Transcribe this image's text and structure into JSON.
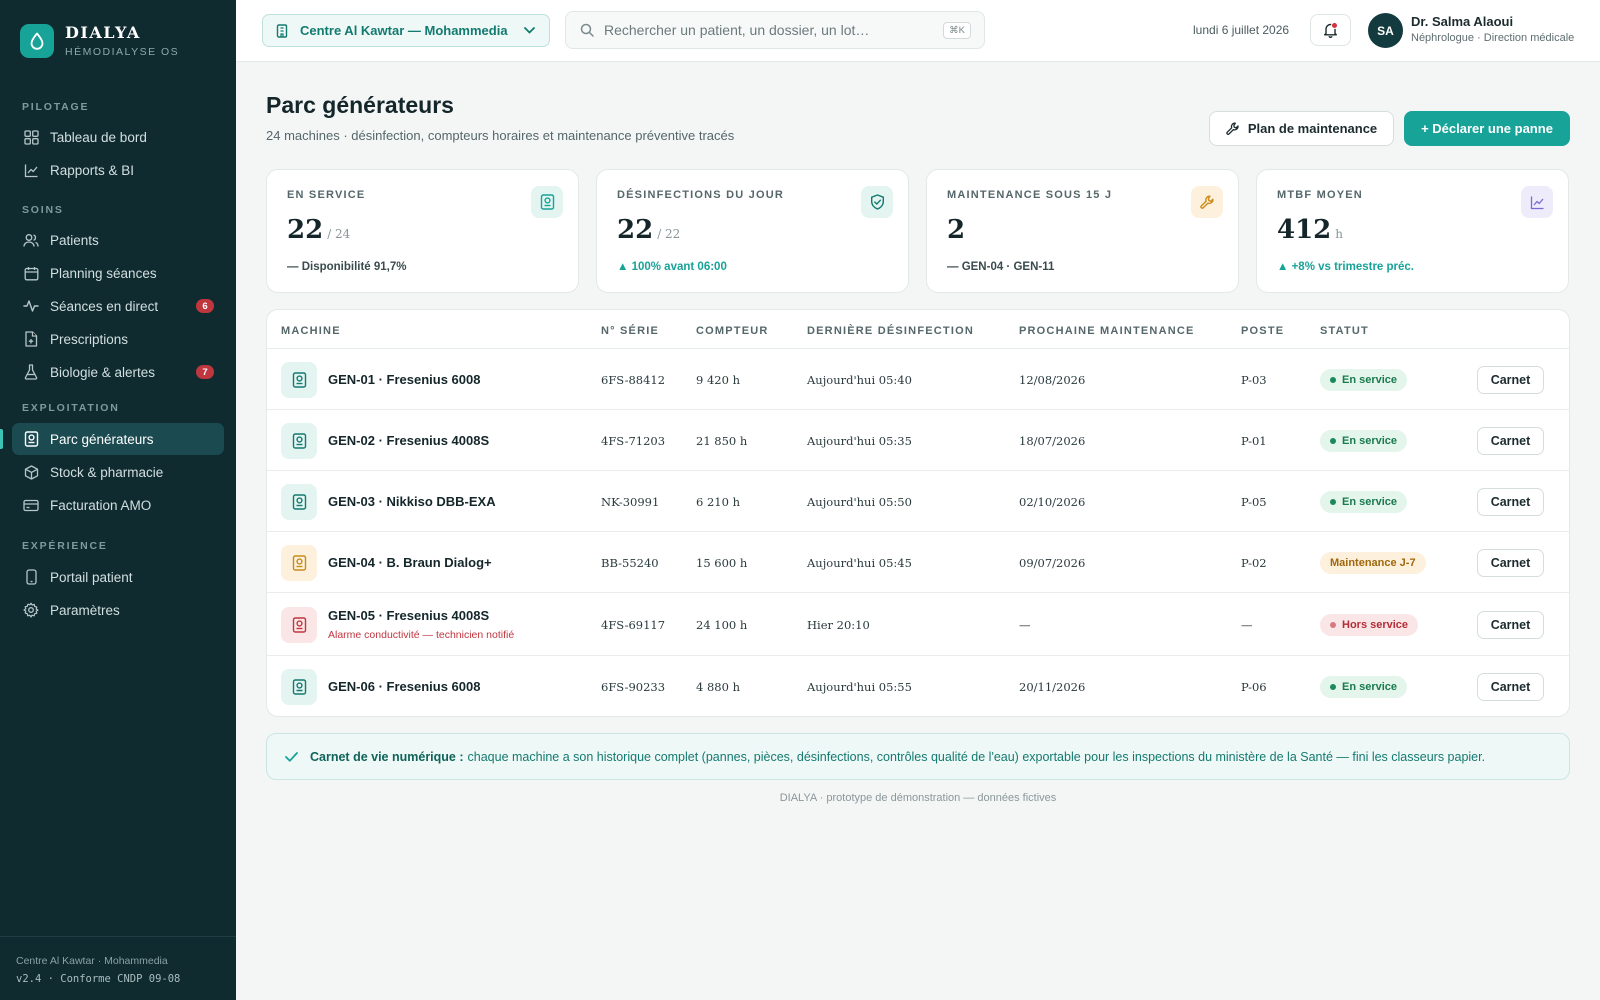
{
  "brand": {
    "name": "DIALYA",
    "subtitle": "HÉMODIALYSE OS"
  },
  "sidebar": {
    "sections": [
      {
        "label": "PILOTAGE",
        "items": [
          {
            "label": "Tableau de bord",
            "icon": "grid-icon"
          },
          {
            "label": "Rapports & BI",
            "icon": "chart-line-icon"
          }
        ]
      },
      {
        "label": "SOINS",
        "items": [
          {
            "label": "Patients",
            "icon": "users-icon"
          },
          {
            "label": "Planning séances",
            "icon": "calendar-icon"
          },
          {
            "label": "Séances en direct",
            "icon": "activity-icon",
            "badge": "6"
          },
          {
            "label": "Prescriptions",
            "icon": "file-plus-icon"
          },
          {
            "label": "Biologie & alertes",
            "icon": "flask-icon",
            "badge": "7"
          }
        ]
      },
      {
        "label": "EXPLOITATION",
        "items": [
          {
            "label": "Parc générateurs",
            "icon": "machine-icon",
            "active": true
          },
          {
            "label": "Stock & pharmacie",
            "icon": "box-icon"
          },
          {
            "label": "Facturation AMO",
            "icon": "credit-card-icon"
          }
        ]
      },
      {
        "label": "EXPÉRIENCE",
        "items": [
          {
            "label": "Portail patient",
            "icon": "phone-icon"
          },
          {
            "label": "Paramètres",
            "icon": "gear-icon"
          }
        ]
      }
    ],
    "footer": {
      "center": "Centre Al Kawtar · Mohammedia",
      "version": "v2.4 · Conforme CNDP 09-08"
    }
  },
  "topbar": {
    "center_select": "Centre Al Kawtar — Mohammedia",
    "search_placeholder": "Rechercher un patient, un dossier, un lot…",
    "search_shortcut": "⌘K",
    "date": "lundi 6 juillet 2026",
    "user": {
      "initials": "SA",
      "name": "Dr. Salma Alaoui",
      "role": "Néphrologue · Direction médicale"
    }
  },
  "page": {
    "title": "Parc générateurs",
    "subtitle": "24 machines · désinfection, compteurs horaires et maintenance préventive tracés",
    "plan_button": "Plan de maintenance",
    "panne_button": "+ Déclarer une panne"
  },
  "kpis": [
    {
      "label": "EN SERVICE",
      "value": "22",
      "unit": "/ 24",
      "foot": "— Disponibilité 91,7%",
      "foot_color": "#3a4a4d",
      "icon": "machine-icon",
      "icon_bg": "#e3f4f1",
      "icon_color": "#17a398"
    },
    {
      "label": "DÉSINFECTIONS DU JOUR",
      "value": "22",
      "unit": "/ 22",
      "foot": "▲ 100% avant 06:00",
      "foot_color": "#17a398",
      "icon": "shield-check-icon",
      "icon_bg": "#e3f4f1",
      "icon_color": "#137a70"
    },
    {
      "label": "MAINTENANCE SOUS 15 J",
      "value": "2",
      "unit": "",
      "foot": "— GEN-04 · GEN-11",
      "foot_color": "#3a4a4d",
      "icon": "wrench-icon",
      "icon_bg": "#fdf0dc",
      "icon_color": "#d08a1a"
    },
    {
      "label": "MTBF MOYEN",
      "value": "412",
      "unit": "h",
      "foot": "▲ +8% vs trimestre préc.",
      "foot_color": "#17a398",
      "icon": "chart-line-icon",
      "icon_bg": "#eeebfb",
      "icon_color": "#7a6ad6"
    }
  ],
  "table": {
    "headers": [
      "MACHINE",
      "N° SÉRIE",
      "COMPTEUR",
      "DERNIÈRE DÉSINFECTION",
      "PROCHAINE MAINTENANCE",
      "POSTE",
      "STATUT"
    ],
    "action_label": "Carnet",
    "rows": [
      {
        "machine": "GEN-01 · Fresenius 6008",
        "serial": "6FS-88412",
        "counter": "9 420 h",
        "last_disinfection": "Aujourd'hui 05:40",
        "next_maintenance": "12/08/2026",
        "post": "P-03",
        "status": "En service",
        "kind": "ok"
      },
      {
        "machine": "GEN-02 · Fresenius 4008S",
        "serial": "4FS-71203",
        "counter": "21 850 h",
        "last_disinfection": "Aujourd'hui 05:35",
        "next_maintenance": "18/07/2026",
        "post": "P-01",
        "status": "En service",
        "kind": "ok"
      },
      {
        "machine": "GEN-03 · Nikkiso DBB-EXA",
        "serial": "NK-30991",
        "counter": "6 210 h",
        "last_disinfection": "Aujourd'hui 05:50",
        "next_maintenance": "02/10/2026",
        "post": "P-05",
        "status": "En service",
        "kind": "ok"
      },
      {
        "machine": "GEN-04 · B. Braun Dialog+",
        "serial": "BB-55240",
        "counter": "15 600 h",
        "last_disinfection": "Aujourd'hui 05:45",
        "next_maintenance": "09/07/2026",
        "post": "P-02",
        "status": "Maintenance J-7",
        "kind": "warn"
      },
      {
        "machine": "GEN-05 · Fresenius 4008S",
        "alert": "Alarme conductivité — technicien notifié",
        "serial": "4FS-69117",
        "counter": "24 100 h",
        "last_disinfection": "Hier 20:10",
        "next_maintenance": "—",
        "post": "—",
        "status": "Hors service",
        "kind": "bad"
      },
      {
        "machine": "GEN-06 · Fresenius 6008",
        "serial": "6FS-90233",
        "counter": "4 880 h",
        "last_disinfection": "Aujourd'hui 05:55",
        "next_maintenance": "20/11/2026",
        "post": "P-06",
        "status": "En service",
        "kind": "ok"
      }
    ]
  },
  "info_banner": {
    "title": "Carnet de vie numérique :",
    "text": "chaque machine a son historique complet (pannes, pièces, désinfections, contrôles qualité de l'eau) exportable pour les inspections du ministère de la Santé — fini les classeurs papier."
  },
  "footnote": "DIALYA · prototype de démonstration — données fictives",
  "colors": {
    "accent": "#17a398",
    "sidebar": "#0f2b30",
    "ok": "#1a8a5a",
    "warn": "#a0680d",
    "bad": "#b32d36"
  }
}
